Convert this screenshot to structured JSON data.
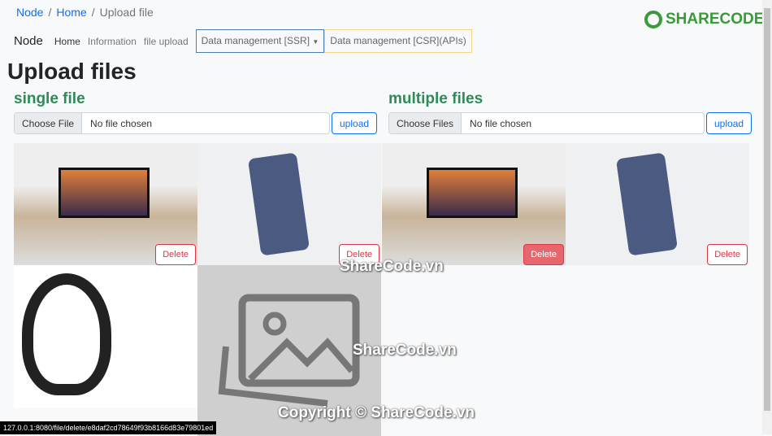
{
  "breadcrumb": [
    "Node",
    "Home",
    "Upload file"
  ],
  "nav": {
    "brand": "Node",
    "links": [
      "Home",
      "Information",
      "file upload"
    ],
    "dropdown": "Data management [SSR]",
    "csr": "Data management [CSR](APIs)"
  },
  "title": "Upload files",
  "single": {
    "heading": "single file",
    "choose": "Choose File",
    "value": "No file chosen",
    "upload": "upload"
  },
  "multiple": {
    "heading": "multiple files",
    "choose": "Choose Files",
    "value": "No file chosen",
    "upload": "upload"
  },
  "delete_label": "Delete",
  "status_url": "127.0.0.1:8080/file/delete/e8daf2cd78649f93b8166d83e79801ed",
  "logo": "SHARECODE.vn",
  "watermarks": [
    "ShareCode.vn",
    "ShareCode.vn",
    "Copyright © ShareCode.vn"
  ]
}
